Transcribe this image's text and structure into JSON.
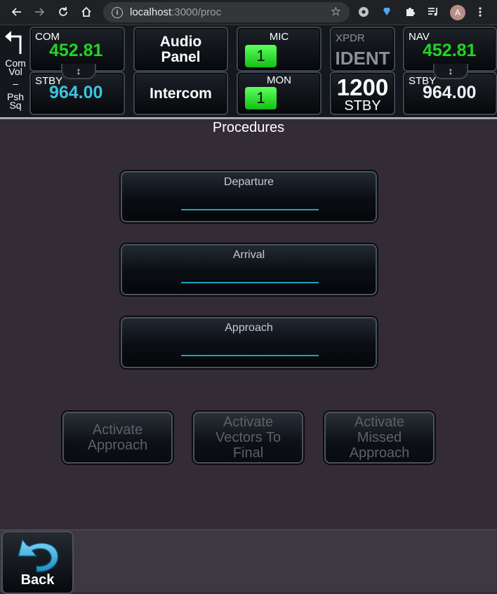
{
  "browser": {
    "url_host": "localhost",
    "url_path": ":3000/proc",
    "avatar_letter": "A"
  },
  "radio": {
    "left_panel": {
      "top_label": "Com Vol",
      "dash": "–",
      "bottom_label": "Psh Sq"
    },
    "com": {
      "label": "COM",
      "active": "452.81",
      "stby_label": "STBY",
      "standby": "964.00"
    },
    "audio": {
      "audio_panel": "Audio Panel",
      "intercom": "Intercom"
    },
    "mic": {
      "label": "MIC",
      "value": "1"
    },
    "mon": {
      "label": "MON",
      "value": "1"
    },
    "xpdr": {
      "label": "XPDR",
      "ident": "IDENT",
      "code": "1200",
      "mode": "STBY"
    },
    "nav": {
      "label": "NAV",
      "active": "452.81",
      "stby_label": "STBY",
      "standby": "964.00"
    },
    "swap_symbol": "↕"
  },
  "page": {
    "title": "Procedures",
    "procedures": [
      {
        "label": "Departure"
      },
      {
        "label": "Arrival"
      },
      {
        "label": "Approach"
      }
    ],
    "actions": [
      {
        "label": "Activate Approach"
      },
      {
        "label": "Activate Vectors To Final"
      },
      {
        "label": "Activate Missed Approach"
      }
    ],
    "back": "Back"
  },
  "colors": {
    "active_freq": "#22d424",
    "standby_freq": "#3bc4df",
    "underline": "#1aa3c3",
    "disabled_text": "#5c6168"
  }
}
